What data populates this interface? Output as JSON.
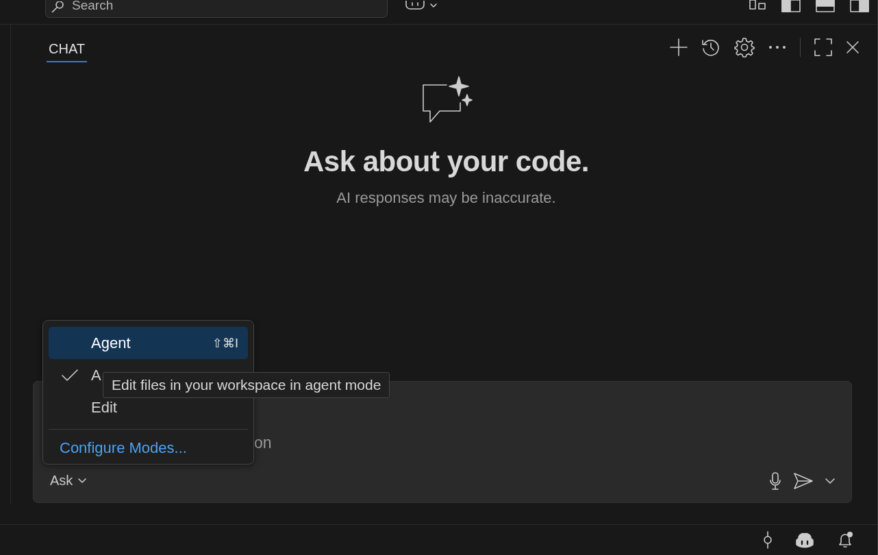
{
  "title_bar": {
    "search": {
      "placeholder": "Search"
    }
  },
  "panel": {
    "tabs": [
      {
        "label": "CHAT",
        "selected": true
      }
    ]
  },
  "welcome": {
    "heading": "Ask about your code.",
    "subtitle": "AI responses may be inaccurate."
  },
  "input": {
    "placeholder": "on",
    "mode": "Ask"
  },
  "mode_menu": {
    "items": [
      {
        "label": "Agent",
        "shortcut": "⇧⌘I",
        "selected": true,
        "checked": false
      },
      {
        "label": "A",
        "selected": false,
        "checked": true
      },
      {
        "label": "Edit",
        "selected": false,
        "checked": false
      }
    ],
    "footer_link": "Configure Modes..."
  },
  "tooltip": "Edit files in your workspace in agent mode"
}
